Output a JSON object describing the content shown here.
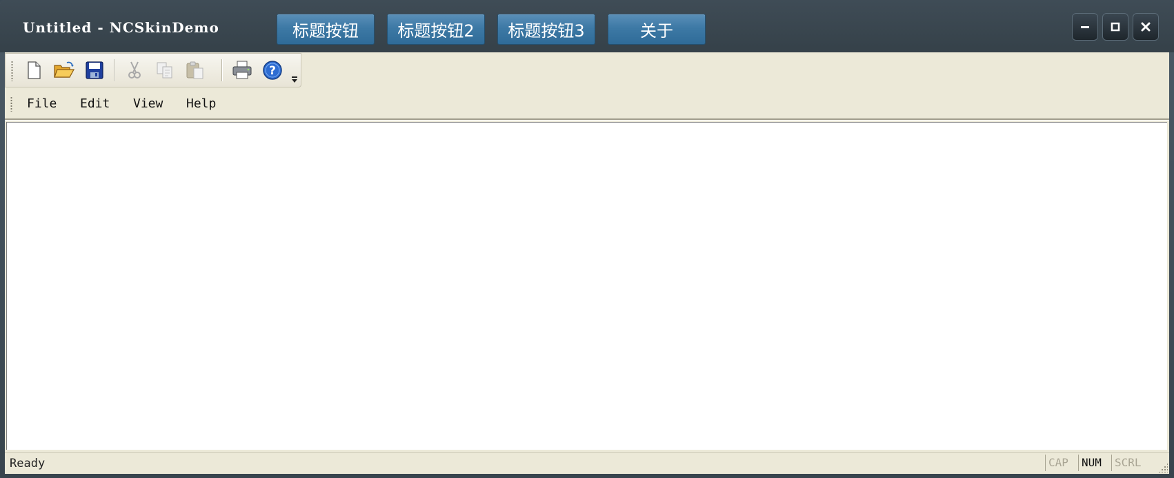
{
  "window": {
    "title": "Untitled - NCSkinDemo"
  },
  "title_buttons": [
    {
      "label": "标题按钮"
    },
    {
      "label": "标题按钮2"
    },
    {
      "label": "标题按钮3"
    },
    {
      "label": "关于"
    }
  ],
  "system_buttons": {
    "minimize": "minimize-icon",
    "maximize": "maximize-icon",
    "close": "close-icon"
  },
  "toolbar": {
    "buttons": [
      "new-file-icon",
      "open-folder-icon",
      "save-icon",
      "cut-icon",
      "copy-icon",
      "paste-icon",
      "print-icon",
      "help-icon"
    ],
    "disabled": [
      "cut-icon",
      "copy-icon",
      "paste-icon"
    ]
  },
  "menu": {
    "items": [
      {
        "label": "File"
      },
      {
        "label": "Edit"
      },
      {
        "label": "View"
      },
      {
        "label": "Help"
      }
    ]
  },
  "status": {
    "text": "Ready",
    "indicators": [
      {
        "label": "CAP",
        "active": false
      },
      {
        "label": "NUM",
        "active": true
      },
      {
        "label": "SCRL",
        "active": false
      }
    ]
  },
  "colors": {
    "title_button": "#3d79a5",
    "frame": "#3c4a55",
    "chrome": "#ece9d8"
  }
}
